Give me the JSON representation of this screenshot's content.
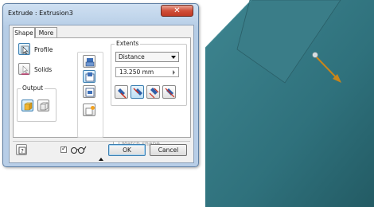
{
  "dialog": {
    "title": "Extrude : Extrusion3",
    "close_icon": "close-x-icon",
    "tabs": [
      {
        "label": "Shape",
        "active": true
      },
      {
        "label": "More",
        "active": false
      }
    ],
    "profile_label": "Profile",
    "solids_label": "Solids",
    "output_label": "Output",
    "extents_label": "Extents",
    "extents_type": "Distance",
    "distance_value": "13.250 mm",
    "match_shape_label": "Match shape",
    "match_shape_checked": false,
    "preview_checked": true,
    "ok_label": "OK",
    "cancel_label": "Cancel",
    "help_icon": "help-icon",
    "preview_icon": "glasses-icon"
  },
  "viewport": {
    "background": "#2f6f7a",
    "arrow_color": "#c9851a"
  }
}
